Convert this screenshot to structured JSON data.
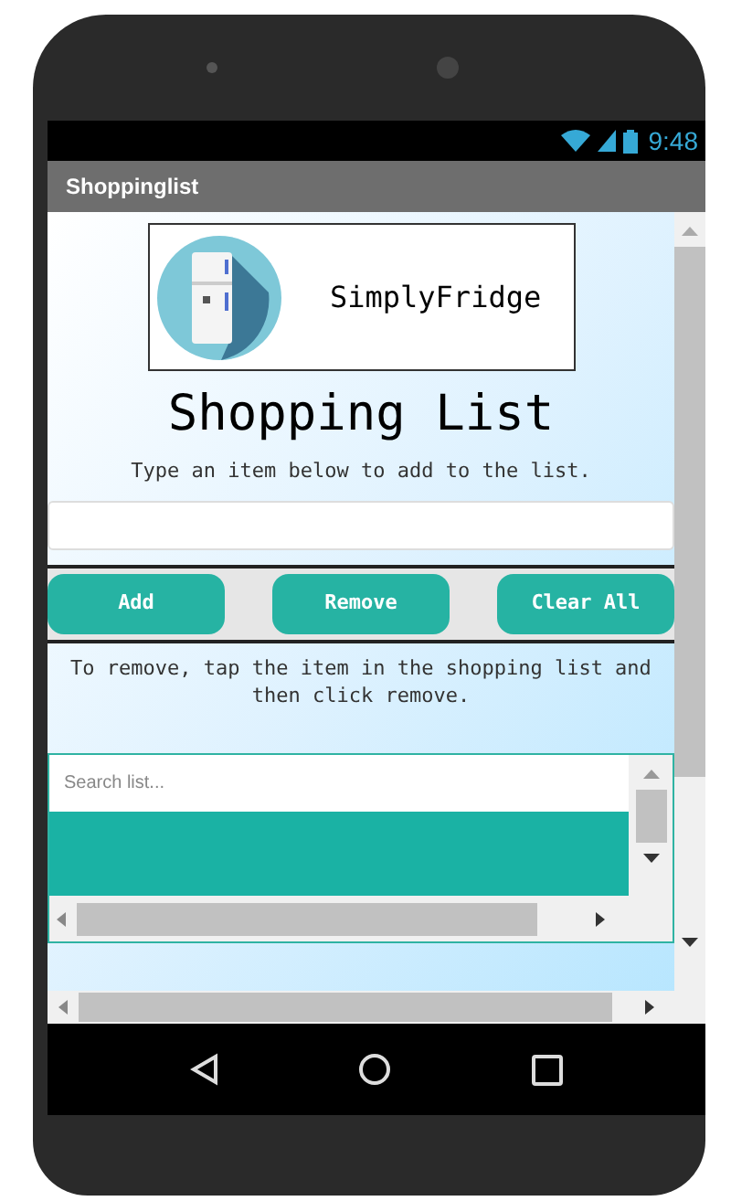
{
  "status_bar": {
    "time": "9:48"
  },
  "title_bar": {
    "title": "Shoppinglist"
  },
  "logo": {
    "text": "SimplyFridge"
  },
  "heading": "Shopping List",
  "instruction": "Type an item below to add to the list.",
  "buttons": [
    {
      "label": "Add"
    },
    {
      "label": "Remove"
    },
    {
      "label": "Clear All"
    }
  ],
  "hint": "To remove, tap the item in the shopping list and then click remove.",
  "list": {
    "search_placeholder": "Search list..."
  }
}
